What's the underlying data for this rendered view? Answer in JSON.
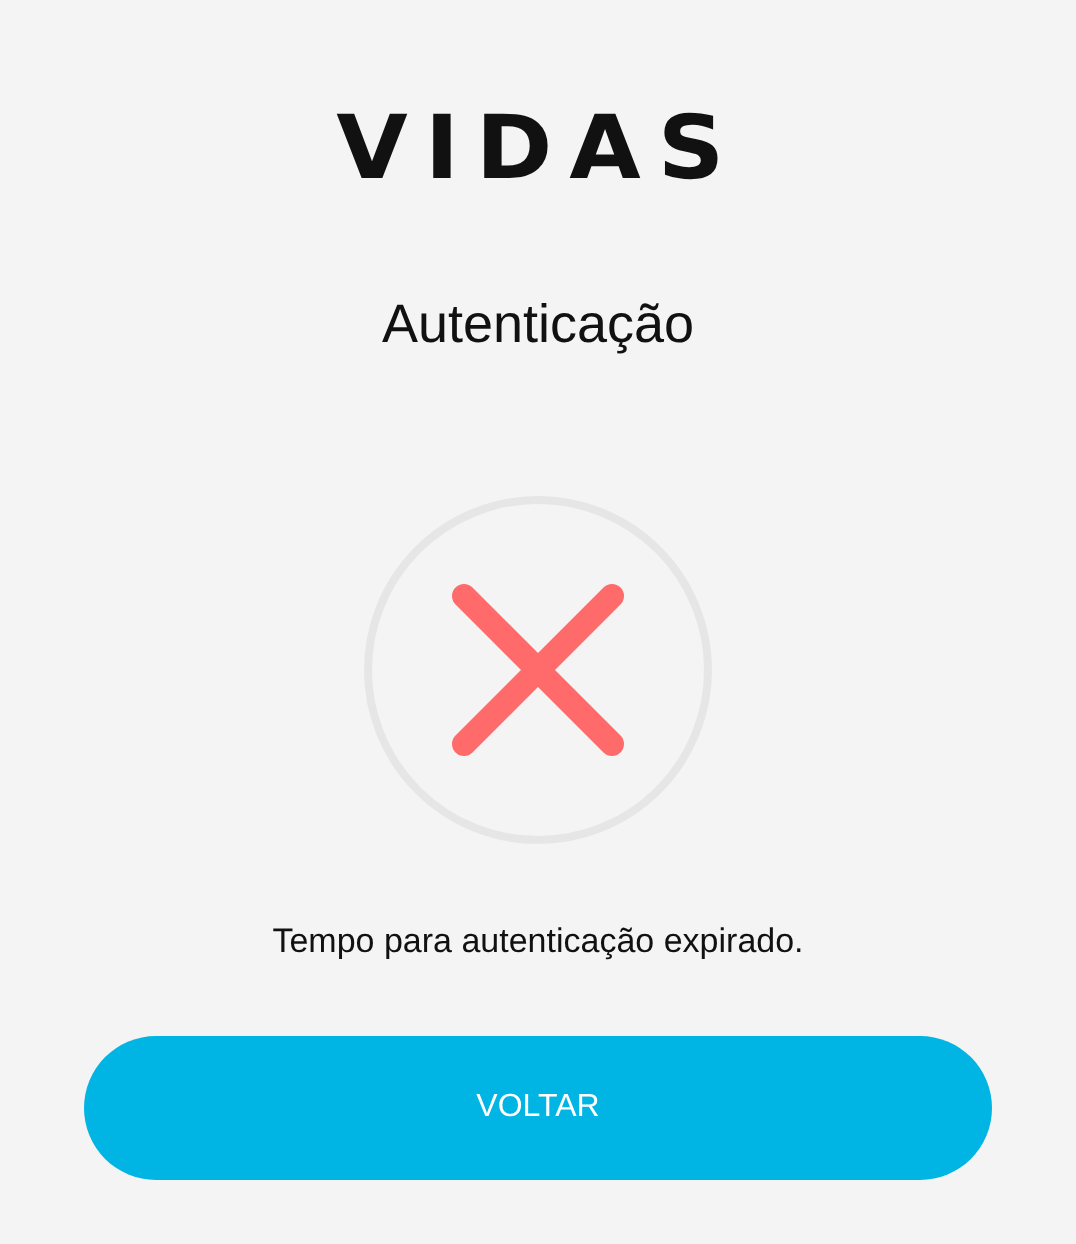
{
  "logo": "VIDAS",
  "title": "Autenticação",
  "status": {
    "kind": "error",
    "message": "Tempo para autenticação expirado."
  },
  "button": {
    "label": "VOLTAR"
  }
}
